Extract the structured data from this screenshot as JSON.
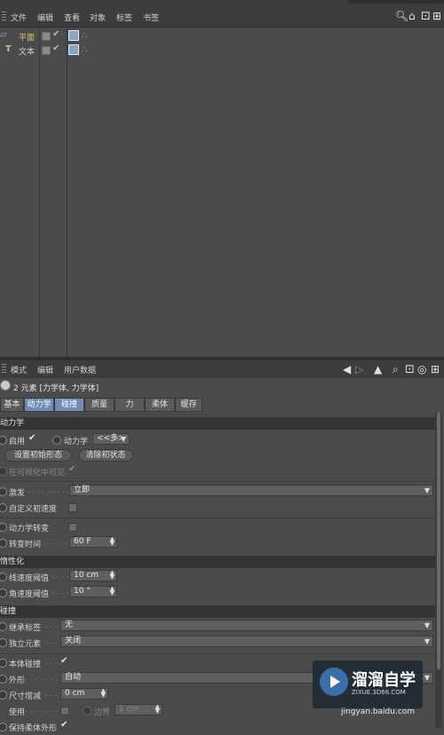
{
  "menubar": {
    "items": [
      "文件",
      "编辑",
      "查看",
      "对象",
      "标签",
      "书签"
    ]
  },
  "objects": [
    {
      "name": "平面",
      "highlight": true
    },
    {
      "name": "文本",
      "highlight": false
    }
  ],
  "attr_menubar": {
    "items": [
      "模式",
      "编辑",
      "用户数据"
    ]
  },
  "selection": "2 元素 [力学体, 力学体]",
  "tabs": [
    "基本",
    "动力学",
    "碰撞",
    "质量",
    "力",
    "柔体",
    "缓存"
  ],
  "dynamics": {
    "section": "动力学",
    "enabled_label": "启用",
    "dynamics_label": "动力学",
    "dynamics_value": "<<多>",
    "set_initial_btn": "设置初始形态",
    "clear_initial_btn": "清除初状态",
    "visible_label": "在可视化中可见",
    "trigger_label": "激发",
    "trigger_value": "立即",
    "custom_vel_label": "自定义初速度",
    "transition_label": "动力学转变",
    "transition_time_label": "转变时间",
    "transition_time_value": "60 F"
  },
  "deactivation": {
    "section": "惰性化",
    "linear_label": "线速度阈值",
    "linear_value": "10 cm",
    "angular_label": "角速度阈值",
    "angular_value": "10 °"
  },
  "collision": {
    "section": "碰撞",
    "inherit_label": "继承标签",
    "inherit_value": "无",
    "independent_label": "独立元素",
    "independent_value": "关闭",
    "self_label": "本体碰撞",
    "shape_label": "外形",
    "shape_value": "自动",
    "size_label": "尺寸增减",
    "size_value": "0 cm",
    "use_label": "使用",
    "margin_label": "边界",
    "margin_value": "1 cm",
    "keep_label": "保持柔体外形"
  },
  "watermark": {
    "title": "溜溜自学",
    "sub": "ZIXUE.3D66.COM",
    "url": "jingyan.baidu.com"
  }
}
